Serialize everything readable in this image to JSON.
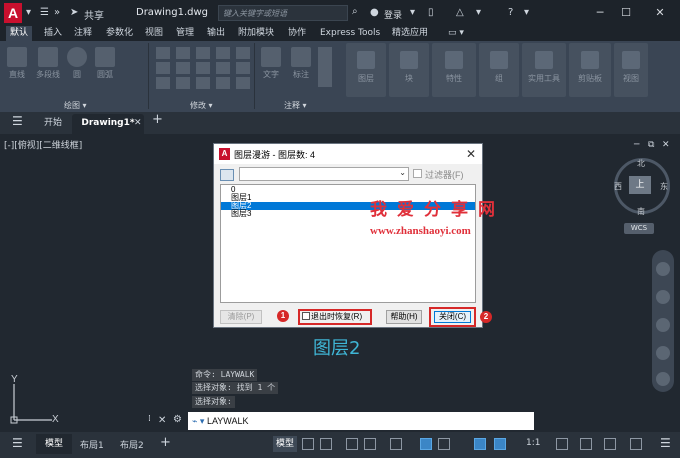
{
  "titlebar": {
    "app_logo": "A",
    "share": "共享",
    "document_title": "Drawing1.dwg",
    "search_placeholder": "键入关键字或短语",
    "login": "登录",
    "minimize": "─",
    "maximize": "☐",
    "close": "✕"
  },
  "ribbon": {
    "tabs": [
      "默认",
      "插入",
      "注释",
      "参数化",
      "视图",
      "管理",
      "输出",
      "附加模块",
      "协作",
      "Express Tools",
      "精选应用",
      "▭ ▾"
    ],
    "draw_tools": [
      "直线",
      "多段线",
      "圆",
      "圆弧"
    ],
    "annotation_tools": [
      "文字",
      "标注"
    ],
    "panels": [
      "图层",
      "块",
      "特性",
      "组",
      "实用工具",
      "剪贴板",
      "视图"
    ],
    "panel_labels": {
      "draw": "绘图 ▾",
      "modify": "修改 ▾",
      "annotation": "注释 ▾"
    }
  },
  "document_tabs": {
    "start": "开始",
    "drawing": "Drawing1*",
    "new_tab": "+"
  },
  "viewport": {
    "label": "[-][俯视][二维线框]",
    "viewcube": {
      "top": "上",
      "north": "北",
      "south": "南",
      "east": "东",
      "west": "西",
      "wcs": "WCS"
    }
  },
  "dialog": {
    "title": "图层漫游 - 图层数: 4",
    "filter_label": "过滤器(F)",
    "layers": [
      {
        "name": "0",
        "selected": false
      },
      {
        "name": "图层1",
        "selected": false
      },
      {
        "name": "图层2",
        "selected": true
      },
      {
        "name": "图层3",
        "selected": false
      }
    ],
    "clear_button": "清除(P)",
    "restore_on_exit": "退出时恢复(R)",
    "help_button": "帮助(H)",
    "close_button": "关闭(C)",
    "callout_1": "1",
    "callout_2": "2"
  },
  "watermark": {
    "title": "我爱分享网",
    "url": "www.zhanshaoyi.com"
  },
  "caption": "图层2",
  "command": {
    "history": [
      "命令: LAYWALK",
      "选择对象: 找到 1 个",
      "选择对象:"
    ],
    "input": "LAYWALK"
  },
  "statusbar": {
    "layout_tabs": [
      "模型",
      "布局1",
      "布局2"
    ],
    "add_layout": "+",
    "model_label": "模型",
    "scale": "1:1"
  },
  "colors": {
    "accent_red": "#d62828",
    "selection_blue": "#0078d7",
    "caption_cyan": "#3fb6d6",
    "canvas": "#212830"
  }
}
